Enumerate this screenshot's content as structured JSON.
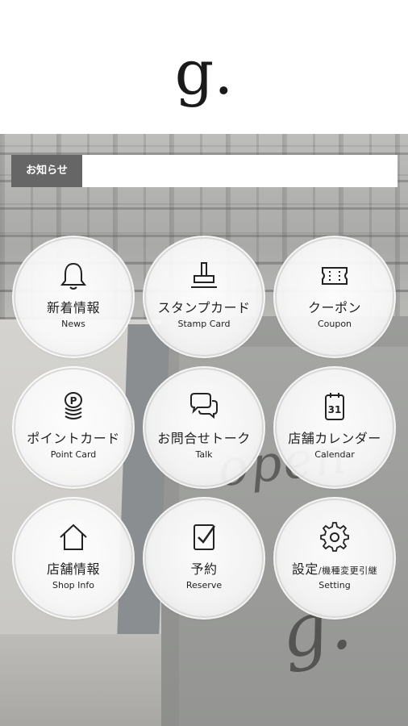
{
  "header": {
    "logo": "g."
  },
  "notice": {
    "label": "お知らせ",
    "text": ""
  },
  "background": {
    "graffiti_text": "open",
    "graffiti_mark": "g."
  },
  "menu": [
    {
      "jp": "新着情報",
      "en": "News",
      "icon": "bell-icon"
    },
    {
      "jp": "スタンプカード",
      "en": "Stamp Card",
      "icon": "stamp-icon"
    },
    {
      "jp": "クーポン",
      "en": "Coupon",
      "icon": "ticket-icon"
    },
    {
      "jp": "ポイントカード",
      "en": "Point Card",
      "icon": "coins-icon"
    },
    {
      "jp": "お問合せトーク",
      "en": "Talk",
      "icon": "chat-bubbles-icon"
    },
    {
      "jp": "店舗カレンダー",
      "en": "Calendar",
      "icon": "calendar-icon",
      "calendar_day": "31"
    },
    {
      "jp": "店舗情報",
      "en": "Shop Info",
      "icon": "home-icon"
    },
    {
      "jp": "予約",
      "en": "Reserve",
      "icon": "reserve-check-icon"
    },
    {
      "jp": "設定",
      "jp_sub": "/機種変更引継",
      "en": "Setting",
      "icon": "gear-icon"
    }
  ]
}
